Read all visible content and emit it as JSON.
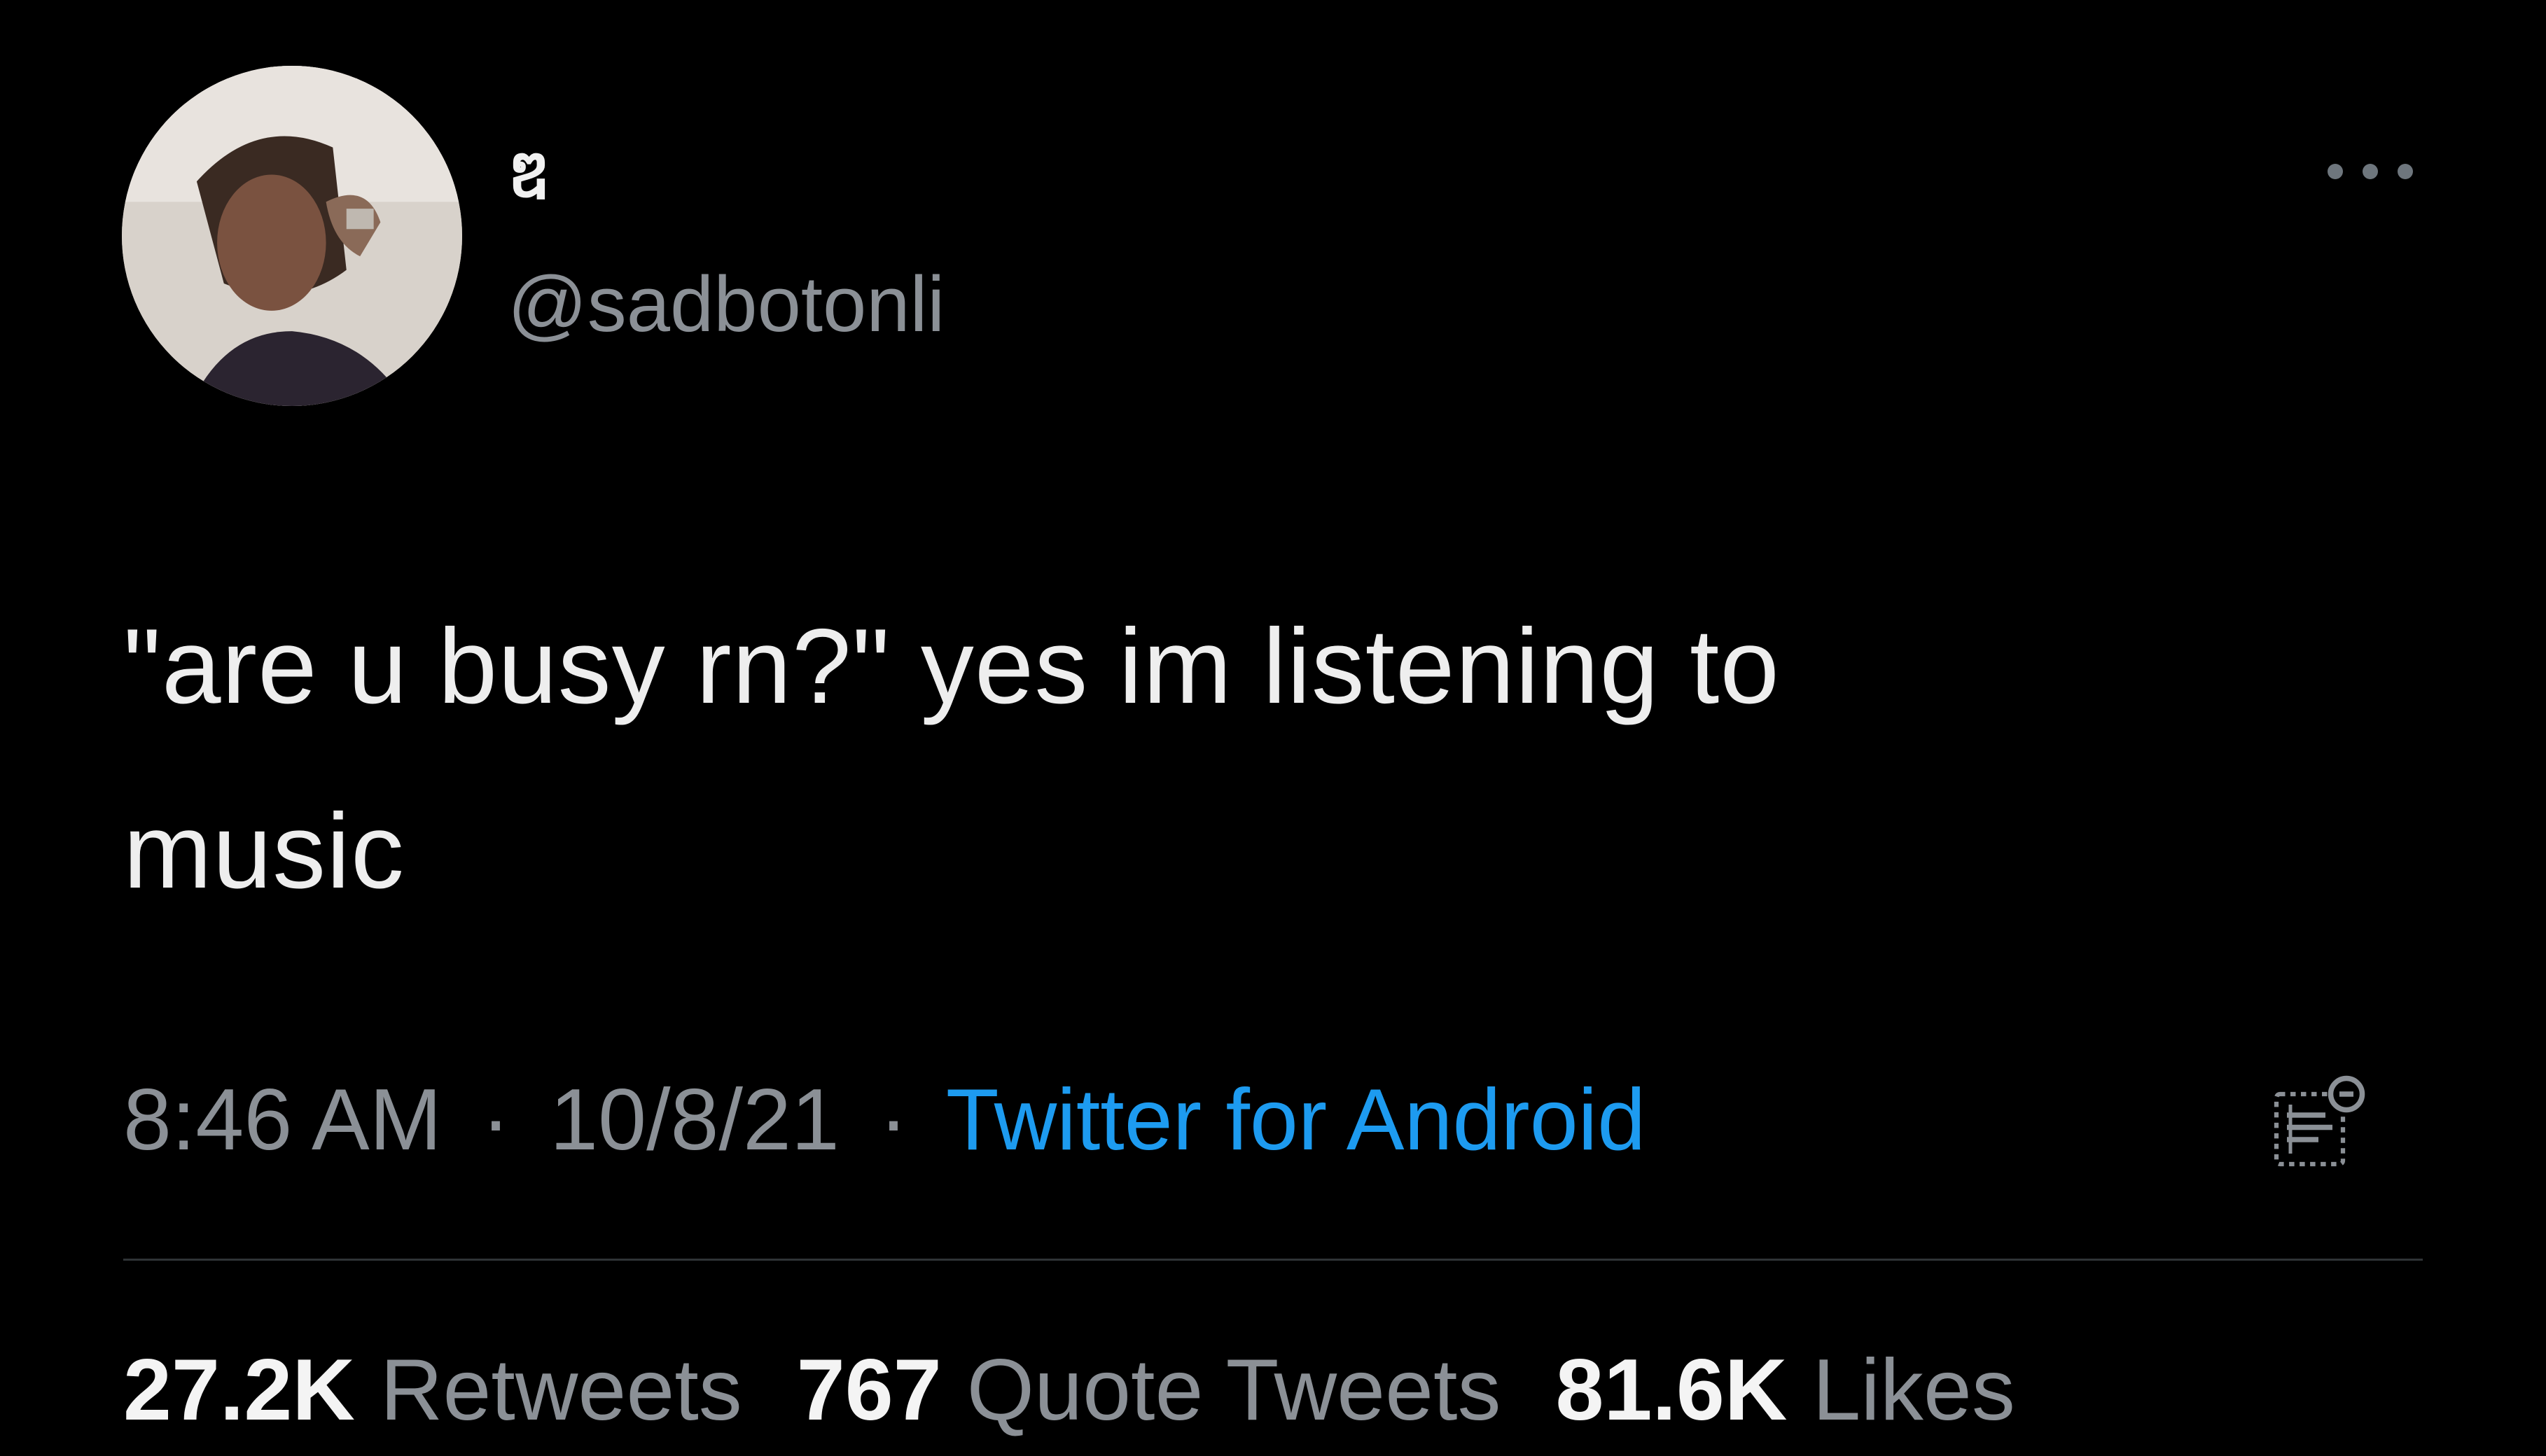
{
  "theme": {
    "background": "#000000",
    "text": "#e7e9ea",
    "secondary_text": "#8b9096",
    "link": "#1d9bf0",
    "divider": "#2f3336"
  },
  "author": {
    "display_name": "ឌ",
    "handle": "@sadbotonli",
    "avatar_icon": "profile-photo"
  },
  "tweet": {
    "text_line1": "\"are u busy rn?\" yes im listening to",
    "text_line2": "music"
  },
  "meta": {
    "time": "8:46 AM",
    "separator": "·",
    "date": "10/8/21",
    "source": "Twitter for Android"
  },
  "stats": {
    "retweets_count": "27.2K",
    "retweets_label": "Retweets",
    "quotes_count": "767",
    "quotes_label": "Quote Tweets",
    "likes_count": "81.6K",
    "likes_label": "Likes"
  },
  "icons": {
    "more": "more-options-icon",
    "analytics": "tweet-analytics-icon"
  }
}
